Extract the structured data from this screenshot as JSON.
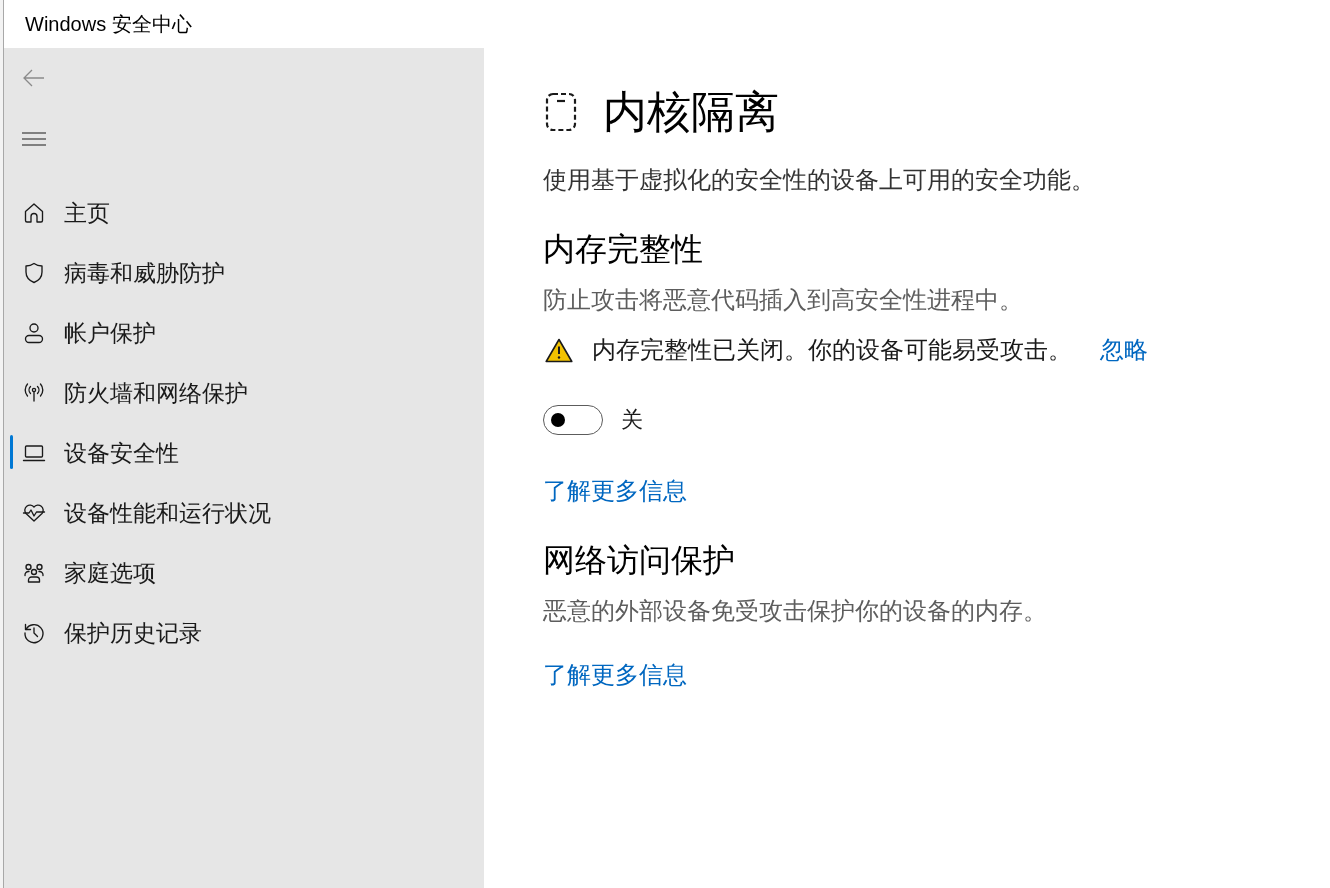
{
  "window": {
    "title": "Windows 安全中心"
  },
  "sidebar": {
    "items": [
      {
        "label": "主页",
        "selected": false
      },
      {
        "label": "病毒和威胁防护",
        "selected": false
      },
      {
        "label": "帐户保护",
        "selected": false
      },
      {
        "label": "防火墙和网络保护",
        "selected": false
      },
      {
        "label": "设备安全性",
        "selected": true
      },
      {
        "label": "设备性能和运行状况",
        "selected": false
      },
      {
        "label": "家庭选项",
        "selected": false
      },
      {
        "label": "保护历史记录",
        "selected": false
      }
    ]
  },
  "page": {
    "title": "内核隔离",
    "description": "使用基于虚拟化的安全性的设备上可用的安全功能。",
    "sections": [
      {
        "heading": "内存完整性",
        "description": "防止攻击将恶意代码插入到高安全性进程中。",
        "warning": {
          "text": "内存完整性已关闭。你的设备可能易受攻击。",
          "action": "忽略"
        },
        "toggle": {
          "on": false,
          "label": "关"
        },
        "link": "了解更多信息"
      },
      {
        "heading": "网络访问保护",
        "description": "恶意的外部设备免受攻击保护你的设备的内存。",
        "link": "了解更多信息"
      }
    ]
  }
}
